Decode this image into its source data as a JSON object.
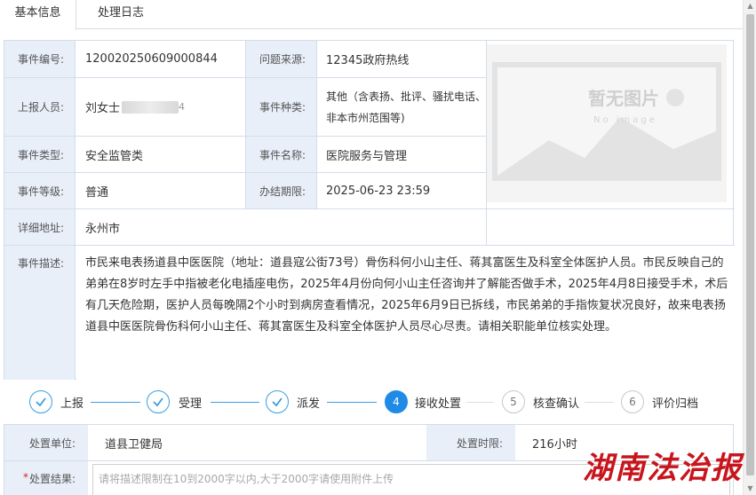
{
  "tabs": [
    {
      "label": "基本信息",
      "active": true
    },
    {
      "label": "处理日志",
      "active": false
    }
  ],
  "info": {
    "event_no_label": "事件编号:",
    "event_no": "120020250609000844",
    "source_label": "问题来源:",
    "source": "12345政府热线",
    "reporter_label": "上报人员:",
    "reporter": "刘女士",
    "reporter_tail": "4",
    "kind_label": "事件种类:",
    "kind_line1": "其他（含表扬、批评、骚扰电话、",
    "kind_line2": "非本市州范围等)",
    "type_label": "事件类型:",
    "type": "安全监管类",
    "name_label": "事件名称:",
    "name": "医院服务与管理",
    "level_label": "事件等级:",
    "level": "普通",
    "deadline_label": "办结期限:",
    "deadline": "2025-06-23 23:59",
    "address_label": "详细地址:",
    "address": "永州市",
    "desc_label": "事件描述:",
    "desc": "市民来电表扬道县中医医院（地址：道县寇公街73号）骨伤科何小山主任、蒋其富医生及科室全体医护人员。市民反映自己的弟弟在8岁时左手中指被老化电插座电伤，2025年4月份向何小山主任咨询并了解能否做手术，2025年4月8日接受手术，术后有几天危险期，医护人员每晚隔2个小时到病房查看情况，2025年6月9日已拆线，市民弟弟的手指恢复状况良好，故来电表扬道县中医医院骨伤科何小山主任、蒋其富医生及科室全体医护人员尽心尽责。请相关职能单位核实处理。",
    "no_image_text": "暂无图片",
    "no_image_sub": "No image"
  },
  "steps": [
    {
      "label": "上报",
      "state": "done",
      "num": "1"
    },
    {
      "label": "受理",
      "state": "done",
      "num": "2"
    },
    {
      "label": "派发",
      "state": "done",
      "num": "3"
    },
    {
      "label": "接收处置",
      "state": "current",
      "num": "4"
    },
    {
      "label": "核查确认",
      "state": "todo",
      "num": "5"
    },
    {
      "label": "评价归档",
      "state": "todo",
      "num": "6"
    }
  ],
  "form": {
    "unit_label": "处置单位:",
    "unit": "道县卫健局",
    "time_label": "处置时限:",
    "time": "216小时",
    "result_label": "处置结果:",
    "result_required": "*",
    "result_placeholder": "请将描述限制在10到2000字以内,大于2000字请使用附件上传"
  },
  "watermark": "湖南法治报",
  "colors": {
    "accent": "#1f8be6",
    "label_bg": "#e8eff9",
    "border": "#d4dde8",
    "watermark": "#c8151d"
  }
}
